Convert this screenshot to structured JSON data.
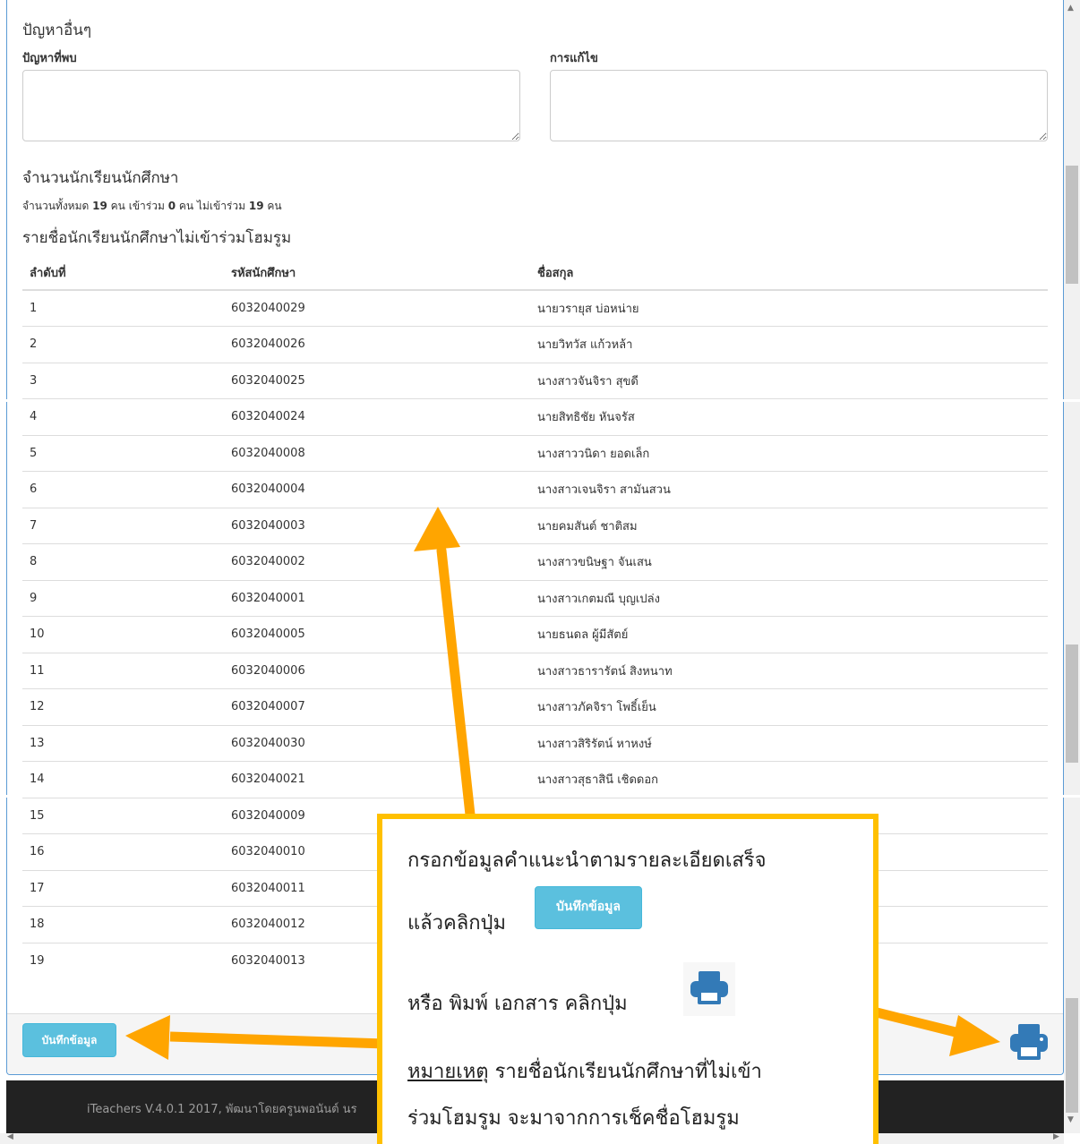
{
  "problems": {
    "section_title": "ปัญหาอื่นๆ",
    "found_label": "ปัญหาที่พบ",
    "fix_label": "การแก้ไข",
    "found_value": "",
    "fix_value": ""
  },
  "students": {
    "section_title": "จำนวนนักเรียนนักศึกษา",
    "total_prefix": "จำนวนทั้งหมด",
    "total": "19",
    "unit": "คน",
    "joined_prefix": "เข้าร่วม",
    "joined": "0",
    "not_joined_prefix": "ไม่เข้าร่วม",
    "not_joined": "19",
    "list_title": "รายชื่อนักเรียนนักศึกษาไม่เข้าร่วมโฮมรูม",
    "columns": [
      "ลำดับที่",
      "รหัสนักศึกษา",
      "ชื่อสกุล"
    ],
    "rows": [
      [
        "1",
        "6032040029",
        "นายวรายุส บ่อหน่าย"
      ],
      [
        "2",
        "6032040026",
        "นายวิทวัส แก้วหล้า"
      ],
      [
        "3",
        "6032040025",
        "นางสาวจันจิรา สุขดี"
      ],
      [
        "4",
        "6032040024",
        "นายสิทธิชัย หันจรัส"
      ],
      [
        "5",
        "6032040008",
        "นางสาววนิดา ยอดเล็ก"
      ],
      [
        "6",
        "6032040004",
        "นางสาวเจนจิรา สามันสวน"
      ],
      [
        "7",
        "6032040003",
        "นายคมสันต์ ชาติสม"
      ],
      [
        "8",
        "6032040002",
        "นางสาวขนิษฐา จันเสน"
      ],
      [
        "9",
        "6032040001",
        "นางสาวเกตมณี บุญเปล่ง"
      ],
      [
        "10",
        "6032040005",
        "นายธนดล ผู้มีสัตย์"
      ],
      [
        "11",
        "6032040006",
        "นางสาวธารารัตน์ สิงหนาท"
      ],
      [
        "12",
        "6032040007",
        "นางสาวภัคจิรา โพธิ์เย็น"
      ],
      [
        "13",
        "6032040030",
        "นางสาวสิริรัตน์ หาหงษ์"
      ],
      [
        "14",
        "6032040021",
        "นางสาวสุธาสินี เชิดดอก"
      ],
      [
        "15",
        "6032040009",
        ""
      ],
      [
        "16",
        "6032040010",
        ""
      ],
      [
        "17",
        "6032040011",
        ""
      ],
      [
        "18",
        "6032040012",
        ""
      ],
      [
        "19",
        "6032040013",
        ""
      ]
    ]
  },
  "footer": {
    "save_label": "บันทึกข้อมูล",
    "print_icon": "print-icon",
    "copyright": "iTeachers V.4.0.1 2017, พัฒนาโดยครูนพอนันต์ นร"
  },
  "callout": {
    "line1": "กรอกข้อมูลคำแนะนำตามรายละเอียดเสร็จ",
    "line2": "แล้วคลิกปุ่ม",
    "button_label": "บันทึกข้อมูล",
    "line3": "หรือ พิมพ์ เอกสาร คลิกปุ่ม",
    "note_label": "หมายเหตุ",
    "line4": "รายชื่อนักเรียนนักศึกษาที่ไม่เข้า",
    "line5": "ร่วมโฮมรูม จะมาจากการเช็คชื่อโฮมรูม"
  },
  "colors": {
    "accent_info": "#5bc0de",
    "print_blue": "#337ab7",
    "callout_border": "#ffc000",
    "arrow_orange": "#ffa500",
    "panel_border": "#5b9bd5"
  }
}
